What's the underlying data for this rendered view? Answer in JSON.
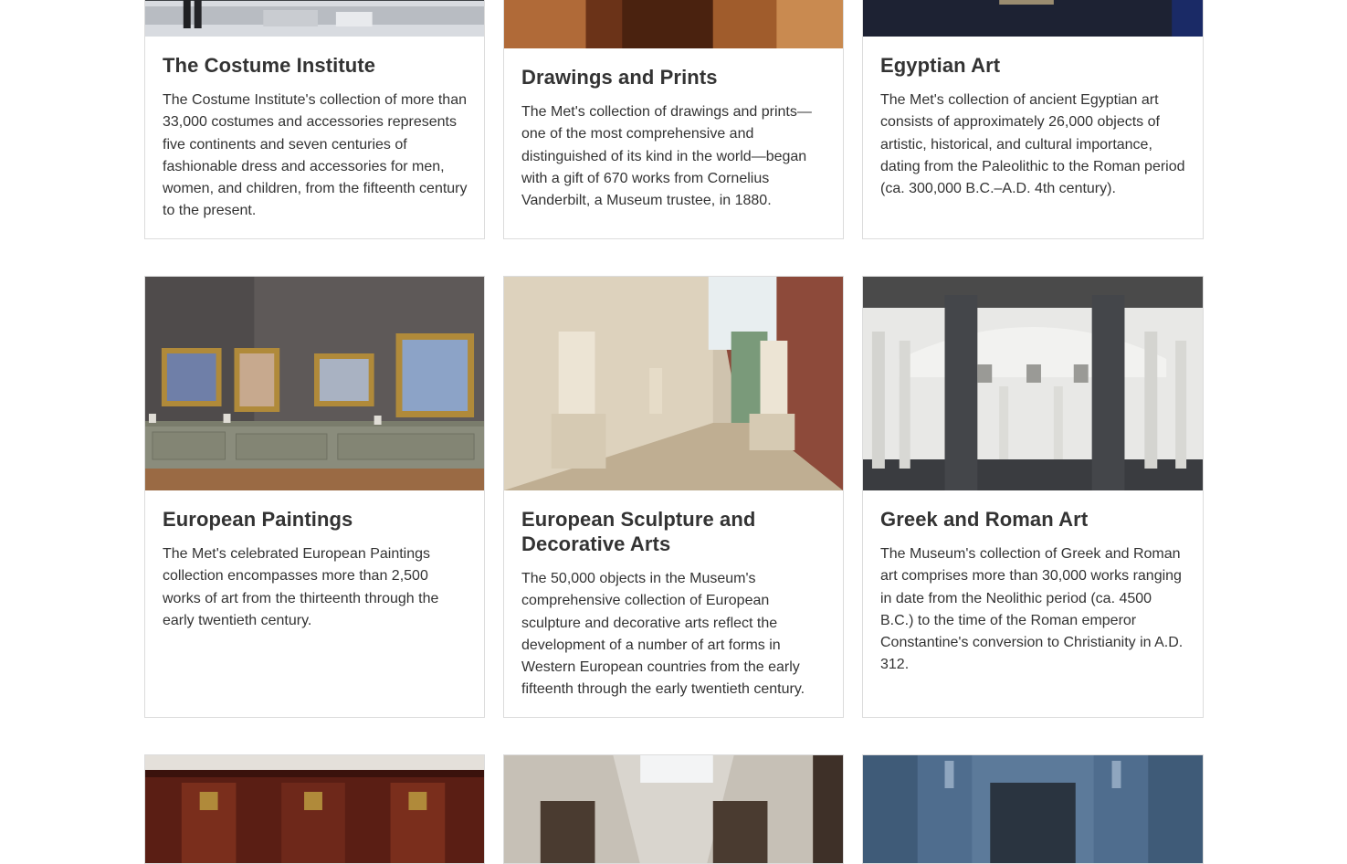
{
  "cards": [
    {
      "title": "The Costume Institute",
      "description": "The Costume Institute's collection of more than 33,000 costumes and accessories represents five continents and seven centuries of fashionable dress and accessories for men, women, and children, from the fifteenth century to the present."
    },
    {
      "title": "Drawings and Prints",
      "description": "The Met's collection of drawings and prints—one of the most comprehensive and distinguished of its kind in the world—began with a gift of 670 works from Cornelius Vanderbilt, a Museum trustee, in 1880."
    },
    {
      "title": "Egyptian Art",
      "description": "The Met's collection of ancient Egyptian art consists of approximately 26,000 objects of artistic, historical, and cultural importance, dating from the Paleolithic to the Roman period (ca. 300,000 B.C.–A.D. 4th century)."
    },
    {
      "title": "European Paintings",
      "description": "The Met's celebrated European Paintings collection encompasses more than 2,500 works of art from the thirteenth through the early twentieth century."
    },
    {
      "title": "European Sculpture and Decorative Arts",
      "description": "The 50,000 objects in the Museum's comprehensive collection of European sculpture and decorative arts reflect the development of a number of art forms in Western European countries from the early fifteenth through the early twentieth century."
    },
    {
      "title": "Greek and Roman Art",
      "description": "The Museum's collection of Greek and Roman art comprises more than 30,000 works ranging in date from the Neolithic period (ca. 4500 B.C.) to the time of the Roman emperor Constantine's conversion to Christianity in A.D. 312."
    }
  ]
}
